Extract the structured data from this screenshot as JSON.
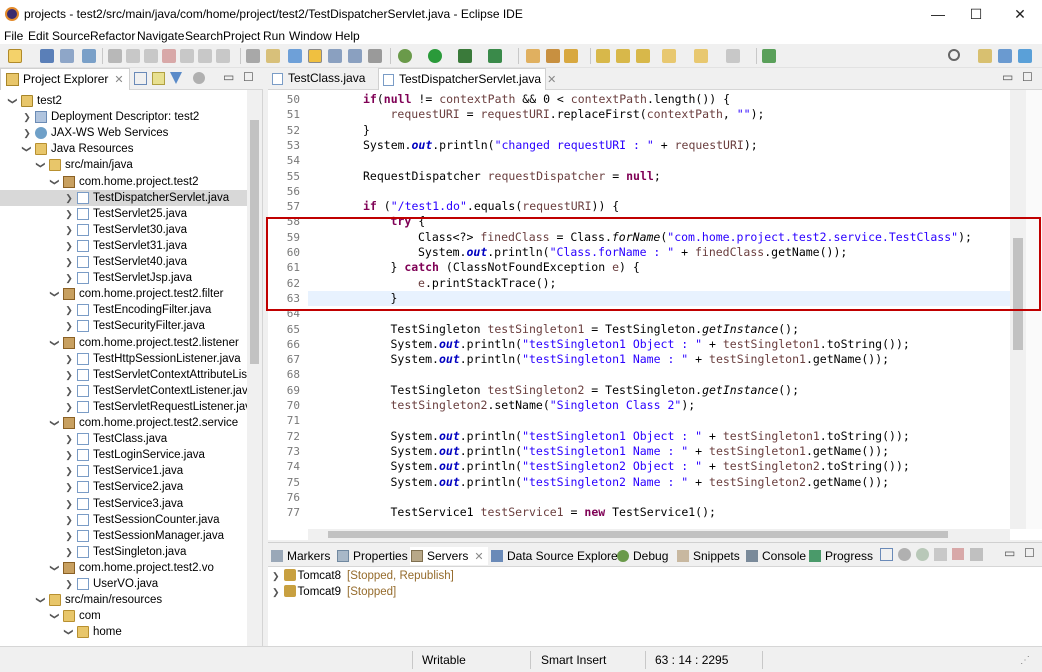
{
  "window": {
    "title": "projects - test2/src/main/java/com/home/project/test2/TestDispatcherServlet.java - Eclipse IDE",
    "minimize": "—",
    "maximize": "☐",
    "close": "✕"
  },
  "menu": [
    "File",
    "Edit",
    "Source",
    "Refactor",
    "Navigate",
    "Search",
    "Project",
    "Run",
    "Window",
    "Help"
  ],
  "explorer": {
    "tab_label": "Project Explorer",
    "tree": [
      {
        "label": "test2",
        "indent": 0,
        "twisty": "open",
        "icon": "project"
      },
      {
        "label": "Deployment Descriptor: test2",
        "indent": 1,
        "twisty": "closed",
        "icon": "deployment-descriptor"
      },
      {
        "label": "JAX-WS Web Services",
        "indent": 1,
        "twisty": "closed",
        "icon": "jaxws"
      },
      {
        "label": "Java Resources",
        "indent": 1,
        "twisty": "open",
        "icon": "folder"
      },
      {
        "label": "src/main/java",
        "indent": 2,
        "twisty": "open",
        "icon": "folder"
      },
      {
        "label": "com.home.project.test2",
        "indent": 3,
        "twisty": "open",
        "icon": "package"
      },
      {
        "label": "TestDispatcherServlet.java",
        "indent": 4,
        "twisty": "closed",
        "icon": "java",
        "selected": true
      },
      {
        "label": "TestServlet25.java",
        "indent": 4,
        "twisty": "closed",
        "icon": "java"
      },
      {
        "label": "TestServlet30.java",
        "indent": 4,
        "twisty": "closed",
        "icon": "java"
      },
      {
        "label": "TestServlet31.java",
        "indent": 4,
        "twisty": "closed",
        "icon": "java"
      },
      {
        "label": "TestServlet40.java",
        "indent": 4,
        "twisty": "closed",
        "icon": "java"
      },
      {
        "label": "TestServletJsp.java",
        "indent": 4,
        "twisty": "closed",
        "icon": "java"
      },
      {
        "label": "com.home.project.test2.filter",
        "indent": 3,
        "twisty": "open",
        "icon": "package"
      },
      {
        "label": "TestEncodingFilter.java",
        "indent": 4,
        "twisty": "closed",
        "icon": "java"
      },
      {
        "label": "TestSecurityFilter.java",
        "indent": 4,
        "twisty": "closed",
        "icon": "java"
      },
      {
        "label": "com.home.project.test2.listener",
        "indent": 3,
        "twisty": "open",
        "icon": "package"
      },
      {
        "label": "TestHttpSessionListener.java",
        "indent": 4,
        "twisty": "closed",
        "icon": "java"
      },
      {
        "label": "TestServletContextAttributeListe",
        "indent": 4,
        "twisty": "closed",
        "icon": "java"
      },
      {
        "label": "TestServletContextListener.java",
        "indent": 4,
        "twisty": "closed",
        "icon": "java"
      },
      {
        "label": "TestServletRequestListener.java",
        "indent": 4,
        "twisty": "closed",
        "icon": "java"
      },
      {
        "label": "com.home.project.test2.service",
        "indent": 3,
        "twisty": "open",
        "icon": "package"
      },
      {
        "label": "TestClass.java",
        "indent": 4,
        "twisty": "closed",
        "icon": "java"
      },
      {
        "label": "TestLoginService.java",
        "indent": 4,
        "twisty": "closed",
        "icon": "java"
      },
      {
        "label": "TestService1.java",
        "indent": 4,
        "twisty": "closed",
        "icon": "java"
      },
      {
        "label": "TestService2.java",
        "indent": 4,
        "twisty": "closed",
        "icon": "java"
      },
      {
        "label": "TestService3.java",
        "indent": 4,
        "twisty": "closed",
        "icon": "java"
      },
      {
        "label": "TestSessionCounter.java",
        "indent": 4,
        "twisty": "closed",
        "icon": "java"
      },
      {
        "label": "TestSessionManager.java",
        "indent": 4,
        "twisty": "closed",
        "icon": "java"
      },
      {
        "label": "TestSingleton.java",
        "indent": 4,
        "twisty": "closed",
        "icon": "java"
      },
      {
        "label": "com.home.project.test2.vo",
        "indent": 3,
        "twisty": "open",
        "icon": "package"
      },
      {
        "label": "UserVO.java",
        "indent": 4,
        "twisty": "closed",
        "icon": "java"
      },
      {
        "label": "src/main/resources",
        "indent": 2,
        "twisty": "open",
        "icon": "folder"
      },
      {
        "label": "com",
        "indent": 3,
        "twisty": "open",
        "icon": "folder"
      },
      {
        "label": "home",
        "indent": 4,
        "twisty": "open",
        "icon": "folder"
      }
    ]
  },
  "editor": {
    "tabs": [
      {
        "label": "TestClass.java",
        "active": false
      },
      {
        "label": "TestDispatcherServlet.java",
        "active": true
      }
    ],
    "current_line": 63,
    "lines": [
      {
        "n": "50",
        "i": 2,
        "t": [
          [
            "kw",
            "if"
          ],
          [
            "",
            "("
          ],
          [
            "kw",
            "null"
          ],
          [
            "",
            " != "
          ],
          [
            "lv",
            "contextPath"
          ],
          [
            "",
            " && 0 < "
          ],
          [
            "lv",
            "contextPath"
          ],
          [
            "",
            ".length()) {"
          ]
        ]
      },
      {
        "n": "51",
        "i": 3,
        "t": [
          [
            "lv",
            "requestURI"
          ],
          [
            "",
            " = "
          ],
          [
            "lv",
            "requestURI"
          ],
          [
            "",
            ".replaceFirst("
          ],
          [
            "lv",
            "contextPath"
          ],
          [
            "",
            ", "
          ],
          [
            "str",
            "\"\""
          ],
          [
            "",
            ");"
          ]
        ]
      },
      {
        "n": "52",
        "i": 2,
        "t": [
          [
            "",
            "}"
          ]
        ]
      },
      {
        "n": "53",
        "i": 2,
        "t": [
          [
            "",
            "System."
          ],
          [
            "fld",
            "out"
          ],
          [
            "",
            ".println("
          ],
          [
            "str",
            "\"changed requestURI : \""
          ],
          [
            "",
            " + "
          ],
          [
            "lv",
            "requestURI"
          ],
          [
            "",
            ");"
          ]
        ]
      },
      {
        "n": "54",
        "i": 0,
        "t": []
      },
      {
        "n": "55",
        "i": 2,
        "t": [
          [
            "",
            "RequestDispatcher "
          ],
          [
            "lv",
            "requestDispatcher"
          ],
          [
            "",
            " = "
          ],
          [
            "kw",
            "null"
          ],
          [
            "",
            ";"
          ]
        ]
      },
      {
        "n": "56",
        "i": 0,
        "t": []
      },
      {
        "n": "57",
        "i": 2,
        "t": [
          [
            "kw",
            "if"
          ],
          [
            "",
            " ("
          ],
          [
            "str",
            "\"/test1.do\""
          ],
          [
            "",
            ".equals("
          ],
          [
            "lv",
            "requestURI"
          ],
          [
            "",
            ")) {"
          ]
        ]
      },
      {
        "n": "58",
        "i": 3,
        "t": [
          [
            "kw",
            "try"
          ],
          [
            "",
            " {"
          ]
        ]
      },
      {
        "n": "59",
        "i": 4,
        "t": [
          [
            "",
            "Class<?> "
          ],
          [
            "lv",
            "finedClass"
          ],
          [
            "",
            " = Class."
          ],
          [
            "it",
            "forName"
          ],
          [
            "",
            "("
          ],
          [
            "str",
            "\"com.home.project.test2.service.TestClass\""
          ],
          [
            "",
            ");"
          ]
        ]
      },
      {
        "n": "60",
        "i": 4,
        "t": [
          [
            "",
            "System."
          ],
          [
            "fld",
            "out"
          ],
          [
            "",
            ".println("
          ],
          [
            "str",
            "\"Class.forName : \""
          ],
          [
            "",
            " + "
          ],
          [
            "lv",
            "finedClass"
          ],
          [
            "",
            ".getName());"
          ]
        ]
      },
      {
        "n": "61",
        "i": 3,
        "t": [
          [
            "",
            "} "
          ],
          [
            "kw",
            "catch"
          ],
          [
            "",
            " (ClassNotFoundException "
          ],
          [
            "lv",
            "e"
          ],
          [
            "",
            ") {"
          ]
        ]
      },
      {
        "n": "62",
        "i": 4,
        "t": [
          [
            "lv",
            "e"
          ],
          [
            "",
            ".printStackTrace();"
          ]
        ]
      },
      {
        "n": "63",
        "i": 3,
        "t": [
          [
            "",
            "}"
          ]
        ]
      },
      {
        "n": "64",
        "i": 0,
        "t": []
      },
      {
        "n": "65",
        "i": 3,
        "t": [
          [
            "",
            "TestSingleton "
          ],
          [
            "lv",
            "testSingleton1"
          ],
          [
            "",
            " = TestSingleton."
          ],
          [
            "it",
            "getInstance"
          ],
          [
            "",
            "();"
          ]
        ]
      },
      {
        "n": "66",
        "i": 3,
        "t": [
          [
            "",
            "System."
          ],
          [
            "fld",
            "out"
          ],
          [
            "",
            ".println("
          ],
          [
            "str",
            "\"testSingleton1 Object : \""
          ],
          [
            "",
            " + "
          ],
          [
            "lv",
            "testSingleton1"
          ],
          [
            "",
            ".toString());"
          ]
        ]
      },
      {
        "n": "67",
        "i": 3,
        "t": [
          [
            "",
            "System."
          ],
          [
            "fld",
            "out"
          ],
          [
            "",
            ".println("
          ],
          [
            "str",
            "\"testSingleton1 Name : \""
          ],
          [
            "",
            " + "
          ],
          [
            "lv",
            "testSingleton1"
          ],
          [
            "",
            ".getName());"
          ]
        ]
      },
      {
        "n": "68",
        "i": 0,
        "t": []
      },
      {
        "n": "69",
        "i": 3,
        "t": [
          [
            "",
            "TestSingleton "
          ],
          [
            "lv",
            "testSingleton2"
          ],
          [
            "",
            " = TestSingleton."
          ],
          [
            "it",
            "getInstance"
          ],
          [
            "",
            "();"
          ]
        ]
      },
      {
        "n": "70",
        "i": 3,
        "t": [
          [
            "lv",
            "testSingleton2"
          ],
          [
            "",
            ".setName("
          ],
          [
            "str",
            "\"Singleton Class 2\""
          ],
          [
            "",
            ");"
          ]
        ]
      },
      {
        "n": "71",
        "i": 0,
        "t": []
      },
      {
        "n": "72",
        "i": 3,
        "t": [
          [
            "",
            "System."
          ],
          [
            "fld",
            "out"
          ],
          [
            "",
            ".println("
          ],
          [
            "str",
            "\"testSingleton1 Object : \""
          ],
          [
            "",
            " + "
          ],
          [
            "lv",
            "testSingleton1"
          ],
          [
            "",
            ".toString());"
          ]
        ]
      },
      {
        "n": "73",
        "i": 3,
        "t": [
          [
            "",
            "System."
          ],
          [
            "fld",
            "out"
          ],
          [
            "",
            ".println("
          ],
          [
            "str",
            "\"testSingleton1 Name : \""
          ],
          [
            "",
            " + "
          ],
          [
            "lv",
            "testSingleton1"
          ],
          [
            "",
            ".getName());"
          ]
        ]
      },
      {
        "n": "74",
        "i": 3,
        "t": [
          [
            "",
            "System."
          ],
          [
            "fld",
            "out"
          ],
          [
            "",
            ".println("
          ],
          [
            "str",
            "\"testSingleton2 Object : \""
          ],
          [
            "",
            " + "
          ],
          [
            "lv",
            "testSingleton2"
          ],
          [
            "",
            ".toString());"
          ]
        ]
      },
      {
        "n": "75",
        "i": 3,
        "t": [
          [
            "",
            "System."
          ],
          [
            "fld",
            "out"
          ],
          [
            "",
            ".println("
          ],
          [
            "str",
            "\"testSingleton2 Name : \""
          ],
          [
            "",
            " + "
          ],
          [
            "lv",
            "testSingleton2"
          ],
          [
            "",
            ".getName());"
          ]
        ]
      },
      {
        "n": "76",
        "i": 0,
        "t": []
      },
      {
        "n": "77",
        "i": 3,
        "t": [
          [
            "",
            "TestService1 "
          ],
          [
            "lv",
            "testService1"
          ],
          [
            "",
            " = "
          ],
          [
            "kw",
            "new"
          ],
          [
            "",
            " TestService1();"
          ]
        ]
      }
    ]
  },
  "bottom_panel": {
    "tabs": [
      {
        "label": "Markers",
        "icon": "markers-icon"
      },
      {
        "label": "Properties",
        "icon": "properties-icon"
      },
      {
        "label": "Servers",
        "icon": "servers-icon",
        "active": true
      },
      {
        "label": "Data Source Explorer",
        "icon": "data-source-icon"
      },
      {
        "label": "Debug",
        "icon": "debug-icon"
      },
      {
        "label": "Snippets",
        "icon": "snippets-icon"
      },
      {
        "label": "Console",
        "icon": "console-icon"
      },
      {
        "label": "Progress",
        "icon": "progress-icon"
      }
    ],
    "servers": [
      {
        "name": "Tomcat8",
        "state": "[Stopped, Republish]"
      },
      {
        "name": "Tomcat9",
        "state": "[Stopped]"
      }
    ]
  },
  "status": {
    "mode": "Writable",
    "insert": "Smart Insert",
    "position": "63 : 14 : 2295"
  },
  "colors": {
    "highlight_border": "#c00000",
    "keyword": "#7f0055",
    "string": "#2a00ff",
    "static_field": "#0000c0",
    "local_variable": "#6a3e3e"
  }
}
